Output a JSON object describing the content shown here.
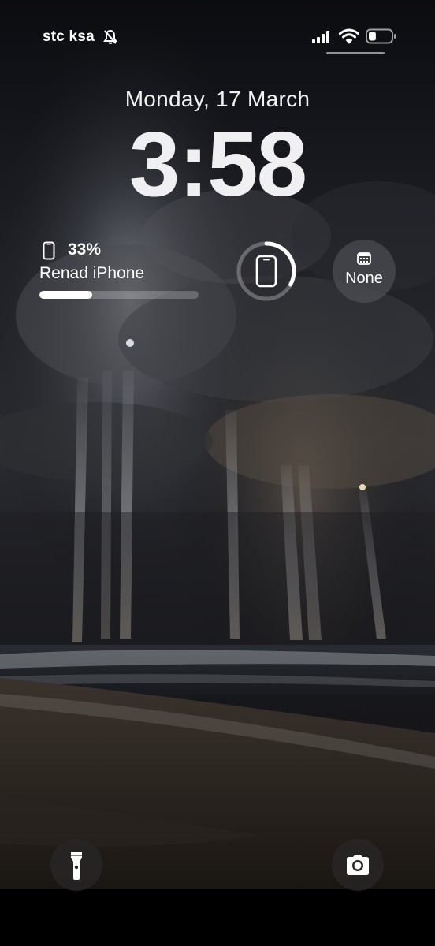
{
  "status_bar": {
    "carrier": "stc ksa",
    "mute_icon": "bell-slash-icon",
    "signal_icon": "cellular-signal-icon",
    "wifi_icon": "wifi-icon",
    "battery_icon": "battery-icon",
    "battery_level": 0.33
  },
  "lock_screen": {
    "date": "Monday, 17 March",
    "time": "3:58"
  },
  "widgets": {
    "battery": {
      "icon": "iphone-icon",
      "percent_text": "33%",
      "device_name": "Renad iPhone",
      "level": 0.33
    },
    "device_ring": {
      "icon": "iphone-icon",
      "level": 0.33
    },
    "calendar": {
      "icon": "calendar-icon",
      "label": "None"
    }
  },
  "quick_actions": {
    "flashlight_icon": "flashlight-icon",
    "camera_icon": "camera-icon"
  },
  "colors": {
    "text": "#ffffff",
    "widget_bg": "#5a5a5f",
    "button_bg": "#282626"
  }
}
